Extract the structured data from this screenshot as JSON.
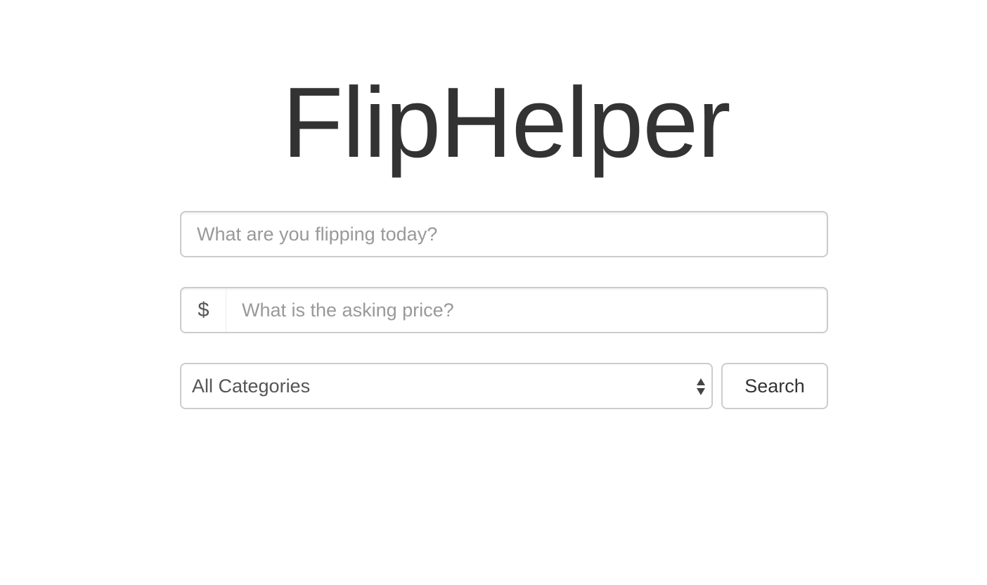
{
  "app": {
    "title": "FlipHelper"
  },
  "form": {
    "item_placeholder": "What are you flipping today?",
    "item_value": "",
    "price_addon": "$",
    "price_placeholder": "What is the asking price?",
    "price_value": "",
    "category_selected": "All Categories",
    "search_label": "Search"
  },
  "icons": {
    "select_arrows": "up-down-caret-icon"
  },
  "colors": {
    "text": "#333333",
    "placeholder": "#999999",
    "border": "#cccccc",
    "background": "#ffffff"
  }
}
